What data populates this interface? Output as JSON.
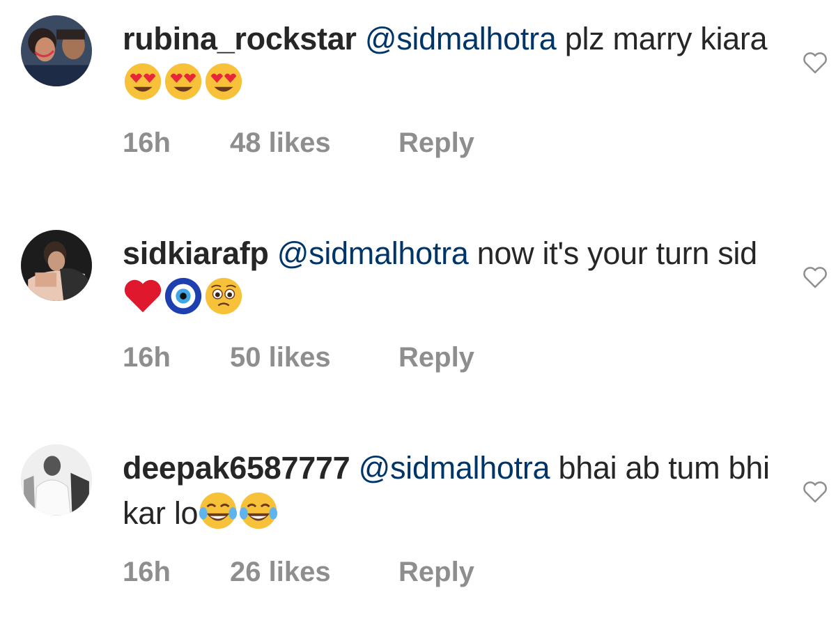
{
  "comments": [
    {
      "avatar": "user-avatar-photo",
      "username": "rubina_rockstar",
      "mention": "@sidmalhotra",
      "text_before_emojis": " plz marry kiara ",
      "emojis": [
        "heart-eyes-emoji",
        "heart-eyes-emoji",
        "heart-eyes-emoji"
      ],
      "time": "16h",
      "likes": "48 likes",
      "reply_label": "Reply",
      "like_icon": "heart-outline-icon"
    },
    {
      "avatar": "user-avatar-photo",
      "username": "sidkiarafp",
      "mention": "@sidmalhotra",
      "text_before_emojis": " now it's your turn sid",
      "emojis": [
        "red-heart-emoji",
        "nazar-amulet-emoji",
        "pleading-face-emoji"
      ],
      "time": "16h",
      "likes": "50 likes",
      "reply_label": "Reply",
      "like_icon": "heart-outline-icon"
    },
    {
      "avatar": "user-avatar-photo",
      "username": "deepak6587777",
      "mention": "@sidmalhotra",
      "text_before_emojis": " bhai ab tum bhi kar lo",
      "emojis": [
        "tears-of-joy-emoji",
        "tears-of-joy-emoji"
      ],
      "time": "16h",
      "likes": "26 likes",
      "reply_label": "Reply",
      "like_icon": "heart-outline-icon"
    }
  ],
  "colors": {
    "username": "#262626",
    "mention": "#003569",
    "meta": "#8e8e8e",
    "heart_icon": "#8e8e8e"
  }
}
